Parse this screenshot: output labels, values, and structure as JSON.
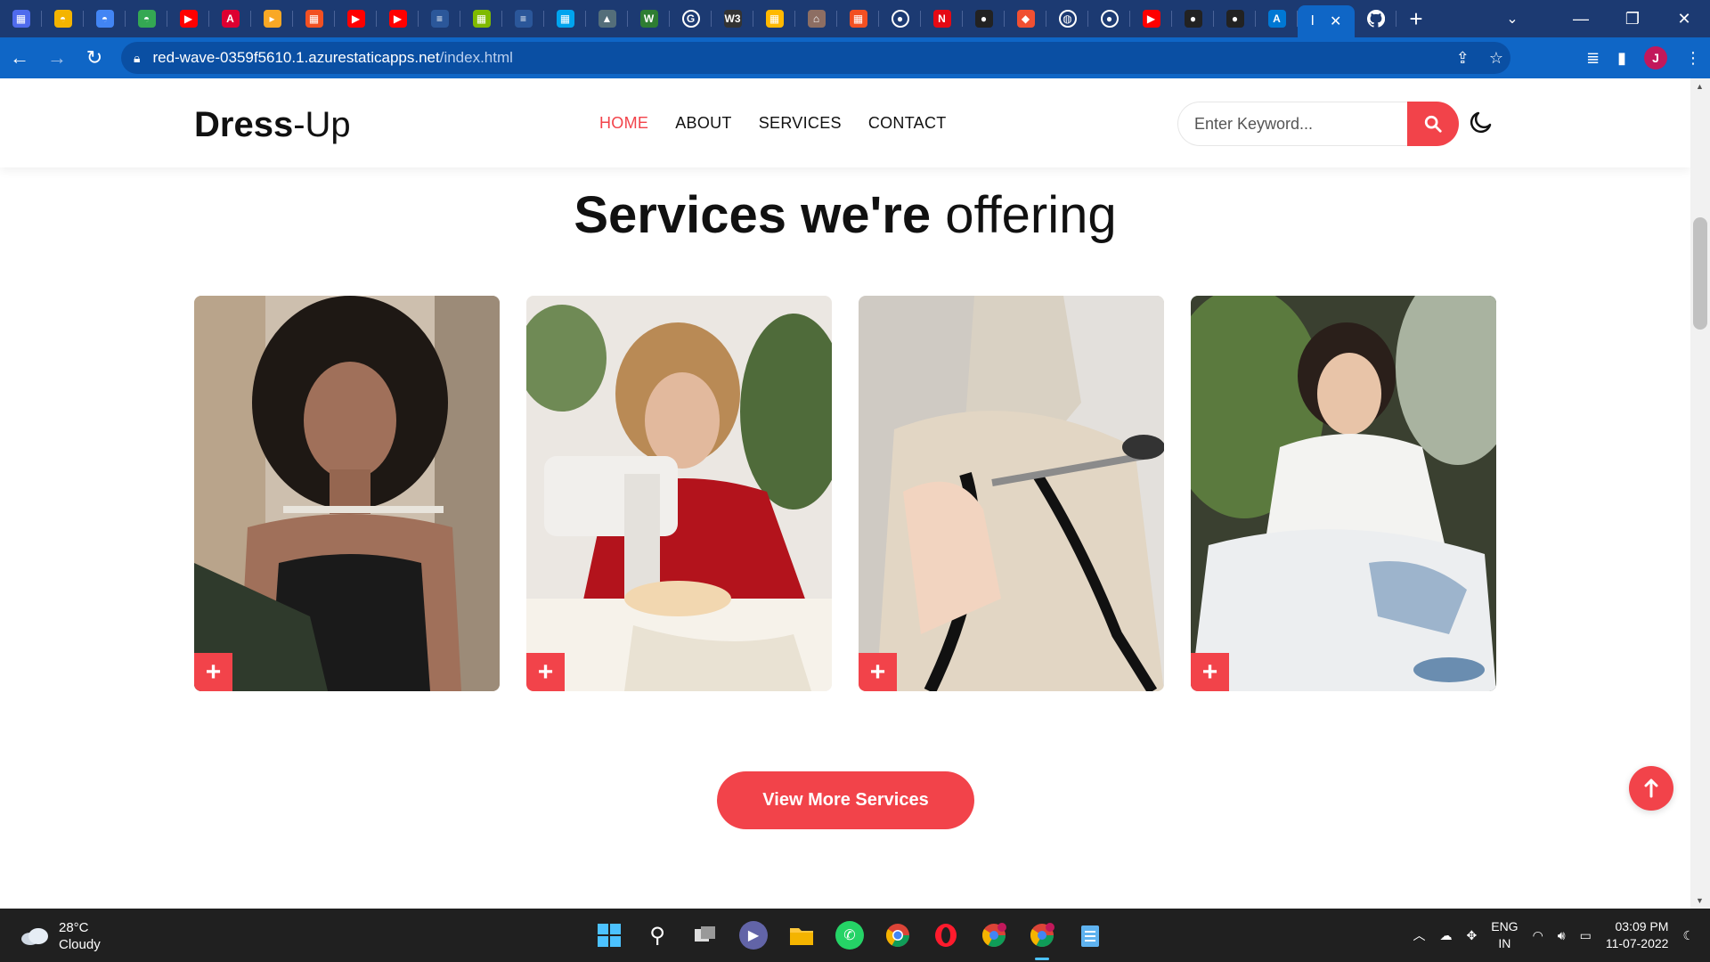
{
  "browser": {
    "tabs": [
      {
        "icon": "taskboard-icon",
        "color": "#4f6bed",
        "glyph": "▦"
      },
      {
        "icon": "google-cloud-icon",
        "color": "#f4b400",
        "glyph": "◓"
      },
      {
        "icon": "google-cloud-icon",
        "color": "#4285f4",
        "glyph": "◓"
      },
      {
        "icon": "google-cloud-icon",
        "color": "#34a853",
        "glyph": "◓"
      },
      {
        "icon": "youtube-icon",
        "color": "#ff0000",
        "glyph": "▶"
      },
      {
        "icon": "angular-icon",
        "color": "#dd0031",
        "glyph": "A"
      },
      {
        "icon": "bookmark-icon",
        "color": "#f9a825",
        "glyph": "▸"
      },
      {
        "icon": "microsoft-icon",
        "color": "#f25022",
        "glyph": "▦"
      },
      {
        "icon": "youtube-icon",
        "color": "#ff0000",
        "glyph": "▶"
      },
      {
        "icon": "youtube-icon",
        "color": "#ff0000",
        "glyph": "▶"
      },
      {
        "icon": "docs-icon",
        "color": "#2b579a",
        "glyph": "≡"
      },
      {
        "icon": "microsoft-icon",
        "color": "#7fba00",
        "glyph": "▦"
      },
      {
        "icon": "docs-icon",
        "color": "#2b579a",
        "glyph": "≡"
      },
      {
        "icon": "microsoft-icon",
        "color": "#00a4ef",
        "glyph": "▦"
      },
      {
        "icon": "mountain-icon",
        "color": "#546e7a",
        "glyph": "▲"
      },
      {
        "icon": "w3-icon",
        "color": "#2e7d32",
        "glyph": "W"
      },
      {
        "icon": "google-icon",
        "color": "#ffffff",
        "glyph": "G"
      },
      {
        "icon": "w3schools-icon",
        "color": "#333333",
        "glyph": "W3"
      },
      {
        "icon": "microsoft-icon",
        "color": "#ffb900",
        "glyph": "▦"
      },
      {
        "icon": "stadium-icon",
        "color": "#8d6e63",
        "glyph": "⌂"
      },
      {
        "icon": "microsoft-icon",
        "color": "#f25022",
        "glyph": "▦"
      },
      {
        "icon": "github-icon",
        "color": "#ffffff",
        "glyph": "●"
      },
      {
        "icon": "netflix-icon",
        "color": "#e50914",
        "glyph": "N"
      },
      {
        "icon": "github-icon",
        "color": "#222222",
        "glyph": "●"
      },
      {
        "icon": "git-icon",
        "color": "#f05032",
        "glyph": "◆"
      },
      {
        "icon": "globe-icon",
        "color": "#ffffff",
        "glyph": "◍"
      },
      {
        "icon": "github-icon",
        "color": "#ffffff",
        "glyph": "●"
      },
      {
        "icon": "youtube-icon",
        "color": "#ff0000",
        "glyph": "▶"
      },
      {
        "icon": "github-icon",
        "color": "#222222",
        "glyph": "●"
      },
      {
        "icon": "github-icon",
        "color": "#222222",
        "glyph": "●"
      },
      {
        "icon": "azure-icon",
        "color": "#0078d4",
        "glyph": "A"
      }
    ],
    "active_tab_label": "I",
    "url_host": "red-wave-0359f5610.1.azurestaticapps.net",
    "url_path": "/index.html"
  },
  "site": {
    "logo_bold": "Dress",
    "logo_light": "-Up",
    "nav": [
      {
        "label": "HOME",
        "active": true
      },
      {
        "label": "ABOUT",
        "active": false
      },
      {
        "label": "SERVICES",
        "active": false
      },
      {
        "label": "CONTACT",
        "active": false
      }
    ],
    "search_placeholder": "Enter Keyword...",
    "heading_bold": "Services we're",
    "heading_light": "offering",
    "cards": [
      {
        "name": "service-card-measuring",
        "plus": "+"
      },
      {
        "name": "service-card-sewing",
        "plus": "+"
      },
      {
        "name": "service-card-tailoring",
        "plus": "+"
      },
      {
        "name": "service-card-handstitching",
        "plus": "+"
      }
    ],
    "more_button": "View More Services",
    "accent_color": "#f2434a"
  },
  "taskbar": {
    "temperature": "28°C",
    "weather": "Cloudy",
    "lang_top": "ENG",
    "lang_bottom": "IN",
    "time": "03:09 PM",
    "date": "11-07-2022"
  }
}
